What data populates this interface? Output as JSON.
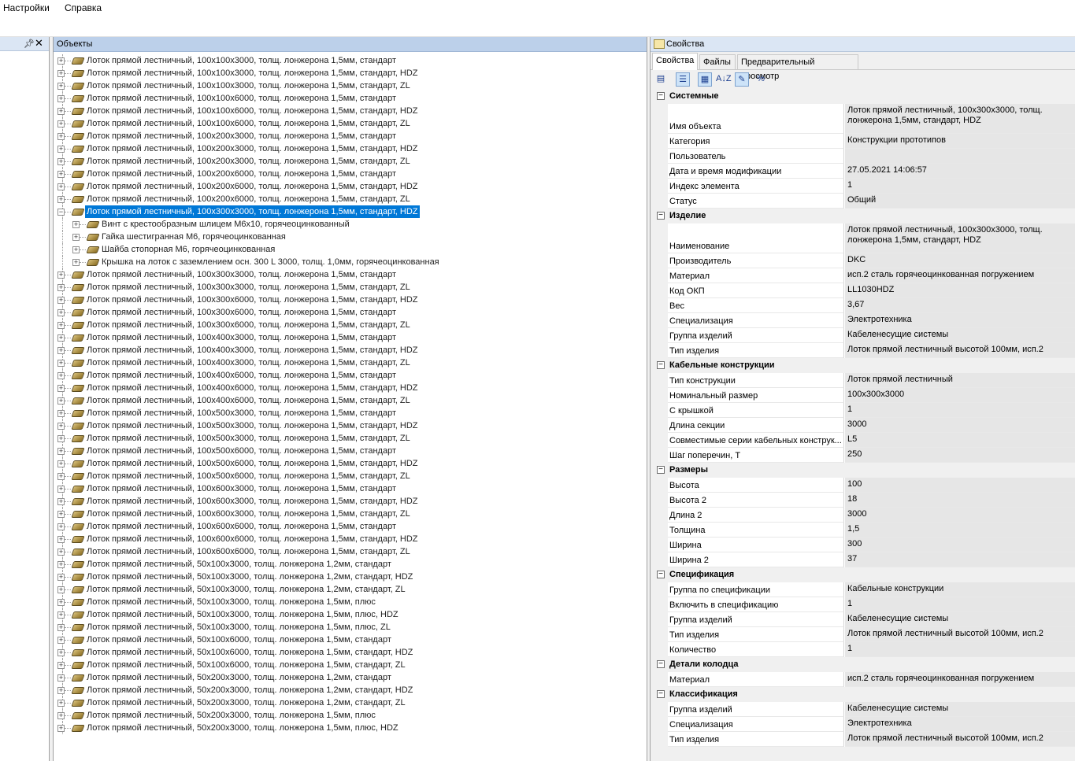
{
  "menu": [
    "Настройки",
    "Справка"
  ],
  "objects_panel": {
    "title": "Объекты",
    "items": [
      {
        "label": "Лоток прямой лестничный, 100x100x3000, толщ. лонжерона 1,5мм, стандарт"
      },
      {
        "label": "Лоток прямой лестничный, 100x100x3000, толщ. лонжерона 1,5мм, стандарт, HDZ"
      },
      {
        "label": "Лоток прямой лестничный, 100x100x3000, толщ. лонжерона 1,5мм, стандарт, ZL"
      },
      {
        "label": "Лоток прямой лестничный, 100x100x6000, толщ. лонжерона 1,5мм, стандарт"
      },
      {
        "label": "Лоток прямой лестничный, 100x100x6000, толщ. лонжерона 1,5мм, стандарт, HDZ"
      },
      {
        "label": "Лоток прямой лестничный, 100x100x6000, толщ. лонжерона 1,5мм, стандарт, ZL"
      },
      {
        "label": "Лоток прямой лестничный, 100x200x3000, толщ. лонжерона 1,5мм, стандарт"
      },
      {
        "label": "Лоток прямой лестничный, 100x200x3000, толщ. лонжерона 1,5мм, стандарт, HDZ"
      },
      {
        "label": "Лоток прямой лестничный, 100x200x3000, толщ. лонжерона 1,5мм, стандарт, ZL"
      },
      {
        "label": "Лоток прямой лестничный, 100x200x6000, толщ. лонжерона 1,5мм, стандарт"
      },
      {
        "label": "Лоток прямой лестничный, 100x200x6000, толщ. лонжерона 1,5мм, стандарт, HDZ"
      },
      {
        "label": "Лоток прямой лестничный, 100x200x6000, толщ. лонжерона 1,5мм, стандарт, ZL"
      },
      {
        "label": "Лоток прямой лестничный, 100x300x3000, толщ. лонжерона 1,5мм,  стандарт, HDZ",
        "expanded": true,
        "selected": true
      },
      {
        "label": "Винт с крестообразным шлицем М6x10, горячеоцинкованный",
        "child": true
      },
      {
        "label": "Гайка шестигранная М6, горячеоцинкованная",
        "child": true
      },
      {
        "label": "Шайба стопорная М6, горячеоцинкованная",
        "child": true
      },
      {
        "label": "Крышка на лоток с заземлением осн. 300 L 3000, толщ. 1,0мм, горячеоцинкованная",
        "child": true
      },
      {
        "label": "Лоток прямой лестничный, 100x300x3000, толщ. лонжерона 1,5мм, стандарт"
      },
      {
        "label": "Лоток прямой лестничный, 100x300x3000, толщ. лонжерона 1,5мм, стандарт, ZL"
      },
      {
        "label": "Лоток прямой лестничный, 100x300x6000, толщ. лонжерона 1,5мм,  стандарт, HDZ"
      },
      {
        "label": "Лоток прямой лестничный, 100x300x6000, толщ. лонжерона 1,5мм, стандарт"
      },
      {
        "label": "Лоток прямой лестничный, 100x300x6000, толщ. лонжерона 1,5мм, стандарт, ZL"
      },
      {
        "label": "Лоток прямой лестничный, 100x400x3000, толщ. лонжерона 1,5мм, стандарт"
      },
      {
        "label": "Лоток прямой лестничный, 100x400x3000, толщ. лонжерона 1,5мм, стандарт, HDZ"
      },
      {
        "label": "Лоток прямой лестничный, 100x400x3000, толщ. лонжерона 1,5мм, стандарт, ZL"
      },
      {
        "label": "Лоток прямой лестничный, 100x400x6000, толщ. лонжерона 1,5мм, стандарт"
      },
      {
        "label": "Лоток прямой лестничный, 100x400x6000, толщ. лонжерона 1,5мм, стандарт, HDZ"
      },
      {
        "label": "Лоток прямой лестничный, 100x400x6000, толщ. лонжерона 1,5мм, стандарт, ZL"
      },
      {
        "label": "Лоток прямой лестничный, 100x500x3000, толщ. лонжерона 1,5мм, стандарт"
      },
      {
        "label": "Лоток прямой лестничный, 100x500x3000, толщ. лонжерона 1,5мм, стандарт, HDZ"
      },
      {
        "label": "Лоток прямой лестничный, 100x500x3000, толщ. лонжерона 1,5мм, стандарт, ZL"
      },
      {
        "label": "Лоток прямой лестничный, 100x500x6000, толщ. лонжерона 1,5мм, стандарт"
      },
      {
        "label": "Лоток прямой лестничный, 100x500x6000, толщ. лонжерона 1,5мм, стандарт, HDZ"
      },
      {
        "label": "Лоток прямой лестничный, 100x500x6000, толщ. лонжерона 1,5мм, стандарт, ZL"
      },
      {
        "label": "Лоток прямой лестничный, 100x600x3000, толщ. лонжерона 1,5мм, стандарт"
      },
      {
        "label": "Лоток прямой лестничный, 100x600x3000, толщ. лонжерона 1,5мм, стандарт, HDZ"
      },
      {
        "label": "Лоток прямой лестничный, 100x600x3000, толщ. лонжерона 1,5мм, стандарт, ZL"
      },
      {
        "label": "Лоток прямой лестничный, 100x600x6000, толщ. лонжерона 1,5мм, стандарт"
      },
      {
        "label": "Лоток прямой лестничный, 100x600x6000, толщ. лонжерона 1,5мм, стандарт, HDZ"
      },
      {
        "label": "Лоток прямой лестничный, 100x600x6000, толщ. лонжерона 1,5мм, стандарт, ZL"
      },
      {
        "label": "Лоток прямой лестничный, 50x100x3000, толщ. лонжерона 1,2мм, стандарт"
      },
      {
        "label": "Лоток прямой лестничный, 50x100x3000, толщ. лонжерона 1,2мм, стандарт, HDZ"
      },
      {
        "label": "Лоток прямой лестничный, 50x100x3000, толщ. лонжерона 1,2мм, стандарт, ZL"
      },
      {
        "label": "Лоток прямой лестничный, 50x100x3000, толщ. лонжерона 1,5мм, плюс"
      },
      {
        "label": "Лоток прямой лестничный, 50x100x3000, толщ. лонжерона 1,5мм, плюс, HDZ"
      },
      {
        "label": "Лоток прямой лестничный, 50x100x3000, толщ. лонжерона 1,5мм, плюс, ZL"
      },
      {
        "label": "Лоток прямой лестничный, 50x100x6000, толщ. лонжерона 1,5мм, стандарт"
      },
      {
        "label": "Лоток прямой лестничный, 50x100x6000, толщ. лонжерона 1,5мм, стандарт, HDZ"
      },
      {
        "label": "Лоток прямой лестничный, 50x100x6000, толщ. лонжерона 1,5мм, стандарт, ZL"
      },
      {
        "label": "Лоток прямой лестничный, 50x200x3000, толщ. лонжерона 1,2мм, стандарт"
      },
      {
        "label": "Лоток прямой лестничный, 50x200x3000, толщ. лонжерона 1,2мм, стандарт, HDZ"
      },
      {
        "label": "Лоток прямой лестничный, 50x200x3000, толщ. лонжерона 1,2мм, стандарт, ZL"
      },
      {
        "label": "Лоток прямой лестничный, 50x200x3000, толщ. лонжерона 1,5мм, плюс"
      },
      {
        "label": "Лоток прямой лестничный, 50x200x3000, толщ. лонжерона 1,5мм, плюс, HDZ"
      }
    ]
  },
  "properties_panel": {
    "title": "Свойства",
    "tabs": [
      {
        "label": "Свойства",
        "active": true
      },
      {
        "label": "Файлы"
      },
      {
        "label": "Предварительный просмотр"
      }
    ],
    "toolbar": [
      {
        "icon": "property-pages-icon"
      },
      {
        "icon": "categorized-icon",
        "pressed": true
      },
      {
        "icon": "grouped-icon",
        "pressed": true
      },
      {
        "icon": "sort-az-icon",
        "text": "A↓Z"
      },
      {
        "icon": "edit-icon",
        "pressed": true
      },
      {
        "icon": "percent-icon",
        "text": "%"
      }
    ],
    "categories": [
      {
        "name": "Системные",
        "props": [
          {
            "name": "Имя объекта",
            "value": "Лоток прямой лестничный, 100x300x3000, толщ. лонжерона 1,5мм,  стандарт, HDZ",
            "tall": true
          },
          {
            "name": "Категория",
            "value": "Конструкции прототипов"
          },
          {
            "name": "Пользователь",
            "value": ""
          },
          {
            "name": "Дата и время модификации",
            "value": "27.05.2021 14:06:57"
          },
          {
            "name": "Индекс элемента",
            "value": "1"
          },
          {
            "name": "Статус",
            "value": "Общий"
          }
        ]
      },
      {
        "name": "Изделие",
        "props": [
          {
            "name": "Наименование",
            "value": "Лоток прямой лестничный, 100x300x3000, толщ. лонжерона 1,5мм,  стандарт, HDZ",
            "tall": true
          },
          {
            "name": "Производитель",
            "value": "DKC"
          },
          {
            "name": "Материал",
            "value": "исп.2 сталь горячеоцинкованная погружением"
          },
          {
            "name": "Код ОКП",
            "value": "LL1030HDZ"
          },
          {
            "name": "Вес",
            "value": "3,67"
          },
          {
            "name": "Специализация",
            "value": "Электротехника"
          },
          {
            "name": "Группа изделий",
            "value": "Кабеленесущие системы"
          },
          {
            "name": "Тип изделия",
            "value": "Лоток прямой лестничный высотой 100мм, исп.2"
          }
        ]
      },
      {
        "name": "Кабельные конструкции",
        "props": [
          {
            "name": "Тип конструкции",
            "value": "Лоток прямой лестничный"
          },
          {
            "name": "Номинальный размер",
            "value": "100x300x3000"
          },
          {
            "name": "С крышкой",
            "value": "1"
          },
          {
            "name": "Длина секции",
            "value": "3000"
          },
          {
            "name": "Совместимые серии кабельных конструк...",
            "value": "L5"
          },
          {
            "name": "Шаг поперечин, T",
            "value": "250"
          }
        ]
      },
      {
        "name": "Размеры",
        "props": [
          {
            "name": "Высота",
            "value": "100"
          },
          {
            "name": "Высота 2",
            "value": "18"
          },
          {
            "name": "Длина 2",
            "value": "3000"
          },
          {
            "name": "Толщина",
            "value": "1,5"
          },
          {
            "name": "Ширина",
            "value": "300"
          },
          {
            "name": "Ширина 2",
            "value": "37"
          }
        ]
      },
      {
        "name": "Спецификация",
        "props": [
          {
            "name": "Группа по спецификации",
            "value": "Кабельные конструкции"
          },
          {
            "name": "Включить в спецификацию",
            "value": "1"
          },
          {
            "name": "Группа изделий",
            "value": "Кабеленесущие системы"
          },
          {
            "name": "Тип изделия",
            "value": "Лоток прямой лестничный высотой 100мм, исп.2"
          },
          {
            "name": "Количество",
            "value": "1"
          }
        ]
      },
      {
        "name": "Детали колодца",
        "props": [
          {
            "name": "Материал",
            "value": "исп.2 сталь горячеоцинкованная погружением"
          }
        ]
      },
      {
        "name": "Классификация",
        "props": [
          {
            "name": "Группа изделий",
            "value": "Кабеленесущие системы"
          },
          {
            "name": "Специализация",
            "value": "Электротехника"
          },
          {
            "name": "Тип изделия",
            "value": "Лоток прямой лестничный высотой 100мм, исп.2"
          }
        ]
      }
    ]
  }
}
